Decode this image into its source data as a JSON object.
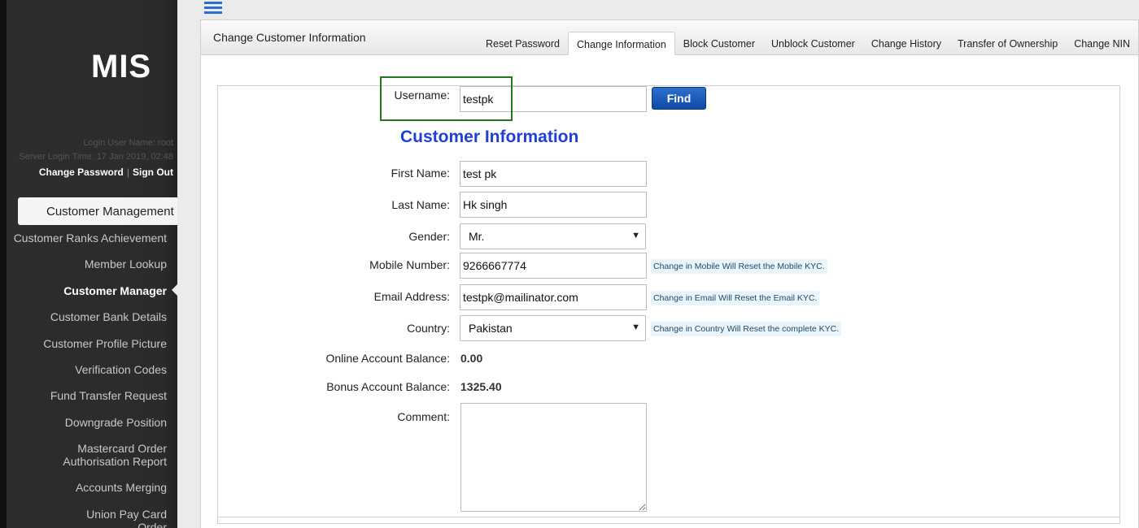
{
  "app": {
    "logo": "MIS"
  },
  "sidebar": {
    "login_user": "Login User Name: root",
    "server_time": "Server Login Time: 17 Jan 2019, 02:48",
    "change_password": "Change Password",
    "separator": "|",
    "sign_out": "Sign Out",
    "section": "Customer Management",
    "items": [
      {
        "label": "Customer Ranks Achievement"
      },
      {
        "label": "Member Lookup"
      },
      {
        "label": "Customer Manager"
      },
      {
        "label": "Customer Bank Details"
      },
      {
        "label": "Customer Profile Picture"
      },
      {
        "label": "Verification Codes"
      },
      {
        "label": "Fund Transfer Request"
      },
      {
        "label": "Downgrade Position"
      },
      {
        "label": "Mastercard Order Authorisation Report"
      },
      {
        "label": "Accounts Merging"
      },
      {
        "label": "Union Pay Card Order AuthorisationReport"
      }
    ],
    "current_item": "Customer Manager"
  },
  "panel": {
    "title": "Change Customer Information",
    "tabs": [
      {
        "label": "Reset Password"
      },
      {
        "label": "Change Information",
        "active": true
      },
      {
        "label": "Block Customer"
      },
      {
        "label": "Unblock Customer"
      },
      {
        "label": "Change History"
      },
      {
        "label": "Transfer of Ownership"
      },
      {
        "label": "Change NIN"
      }
    ]
  },
  "form": {
    "username_label": "Username:",
    "username_value": "testpk",
    "find_label": "Find",
    "section_title": "Customer Information",
    "first_name_label": "First Name:",
    "first_name_value": "test pk",
    "last_name_label": "Last Name:",
    "last_name_value": "Hk singh",
    "gender_label": "Gender:",
    "gender_value": "Mr.",
    "mobile_label": "Mobile Number:",
    "mobile_value": "9266667774",
    "mobile_note": "Change in Mobile Will Reset the Mobile KYC.",
    "email_label": "Email Address:",
    "email_value": "testpk@mailinator.com",
    "email_note": "Change in Email Will Reset the Email KYC.",
    "country_label": "Country:",
    "country_value": "Pakistan",
    "country_note": "Change in Country Will Reset the complete KYC.",
    "online_balance_label": "Online Account Balance:",
    "online_balance_value": "0.00",
    "bonus_balance_label": "Bonus Account Balance:",
    "bonus_balance_value": "1325.40",
    "comment_label": "Comment:",
    "comment_value": ""
  },
  "colors": {
    "accent": "#1f3fd8",
    "highlight": "#1f7a1f",
    "button": "#0f4aa3"
  }
}
